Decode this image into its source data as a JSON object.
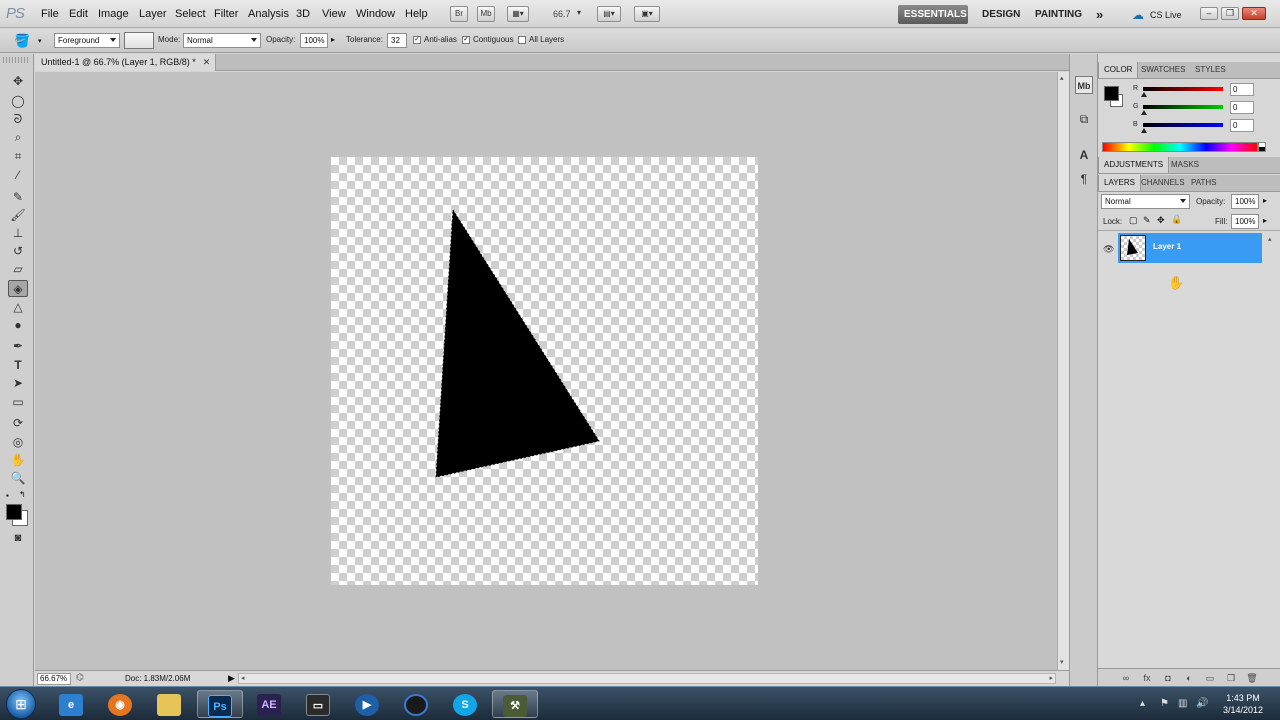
{
  "app": {
    "logo": "PS"
  },
  "menu": [
    "File",
    "Edit",
    "Image",
    "Layer",
    "Select",
    "Filter",
    "Analysis",
    "3D",
    "View",
    "Window",
    "Help"
  ],
  "appbar": {
    "zoom": "66.7",
    "bridge_btn": "Br",
    "minibridge_btn": "Mb"
  },
  "workspaces": {
    "essentials": "ESSENTIALS",
    "design": "DESIGN",
    "painting": "PAINTING",
    "more": "»"
  },
  "cslive": "CS Live",
  "options": {
    "fill_source": "Foreground",
    "mode_label": "Mode:",
    "mode_value": "Normal",
    "opacity_label": "Opacity:",
    "opacity_value": "100%",
    "tolerance_label": "Tolerance:",
    "tolerance_value": "32",
    "antialias_label": "Anti-alias",
    "contiguous_label": "Contiguous",
    "all_layers_label": "All Layers"
  },
  "document": {
    "tab_title": "Untitled-1 @ 66.7% (Layer 1, RGB/8) *",
    "zoom_status": "66.67%",
    "doc_info": "Doc: 1.83M/2.06M"
  },
  "color_panel": {
    "tabs": [
      "COLOR",
      "SWATCHES",
      "STYLES"
    ],
    "r_label": "R",
    "g_label": "G",
    "b_label": "B",
    "r": "0",
    "g": "0",
    "b": "0",
    "foreground_color": "#000000",
    "background_color": "#ffffff"
  },
  "adjust_panel": {
    "tabs": [
      "ADJUSTMENTS",
      "MASKS"
    ]
  },
  "layers_panel": {
    "tabs": [
      "LAYERS",
      "CHANNELS",
      "PATHS"
    ],
    "blend_mode": "Normal",
    "opacity_label": "Opacity:",
    "opacity_value": "100%",
    "lock_label": "Lock:",
    "fill_label": "Fill:",
    "fill_value": "100%",
    "layers": [
      {
        "name": "Layer 1",
        "visible": true,
        "selected": true
      }
    ]
  },
  "taskbar": {
    "clock_time": "1:43 PM",
    "clock_date": "3/14/2012",
    "apps": [
      "Internet Explorer",
      "Firefox",
      "Windows Explorer",
      "Photoshop",
      "After Effects",
      "Media",
      "Windows Media Player",
      "Cinema 4D",
      "Skype",
      "Utility"
    ],
    "ps_label": "Ps",
    "ae_label": "AE"
  },
  "colors": {
    "accent_selection": "#3a9bf2",
    "canvas_bg": "#c1c1c1",
    "shape_fill": "#000000"
  }
}
